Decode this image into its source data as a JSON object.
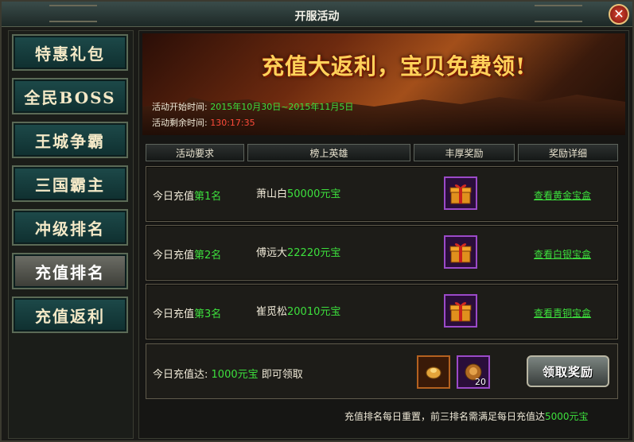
{
  "window": {
    "title": "开服活动"
  },
  "sidebar": {
    "items": [
      {
        "label": "特惠礼包",
        "active": false
      },
      {
        "label": "全民BOSS",
        "active": false
      },
      {
        "label": "王城争霸",
        "active": false
      },
      {
        "label": "三国霸主",
        "active": false
      },
      {
        "label": "冲级排名",
        "active": false
      },
      {
        "label": "充值排名",
        "active": true
      },
      {
        "label": "充值返利",
        "active": false
      }
    ]
  },
  "banner": {
    "headline": "充值大返利，宝贝免费领!",
    "start_label": "活动开始时间:",
    "start_value": "2015年10月30日~2015年11月5日",
    "remain_label": "活动剩余时间:",
    "remain_value": "130:17:35"
  },
  "table": {
    "headers": [
      "活动要求",
      "榜上英雄",
      "丰厚奖励",
      "奖励详细"
    ],
    "rows": [
      {
        "req_prefix": "今日充值",
        "rank": "第1名",
        "hero": "萧山白",
        "amount": "50000元宝",
        "link": "查看黄金宝盒",
        "reward_icon": "gift-box-icon"
      },
      {
        "req_prefix": "今日充值",
        "rank": "第2名",
        "hero": "傅远大",
        "amount": "22220元宝",
        "link": "查看白银宝盒",
        "reward_icon": "gift-box-icon"
      },
      {
        "req_prefix": "今日充值",
        "rank": "第3名",
        "hero": "崔觅松",
        "amount": "20010元宝",
        "link": "查看青铜宝盒",
        "reward_icon": "gift-box-icon"
      }
    ]
  },
  "bottom": {
    "text_prefix": "今日充值达:",
    "amount": "1000元宝",
    "text_suffix": "即可领取",
    "item1_icon": "gold-ingot-icon",
    "item2_icon": "coin-pouch-icon",
    "item2_count": "20",
    "claim_label": "领取奖励"
  },
  "footer": {
    "note_prefix": "充值排名每日重置，前三排名需满足每日充值达",
    "note_amount": "5000元宝"
  },
  "colors": {
    "accent_green": "#3de03d",
    "countdown_red": "#ff4b3a",
    "title_gold": "#ffd25a",
    "nav_teal": "#1d4a4a"
  }
}
